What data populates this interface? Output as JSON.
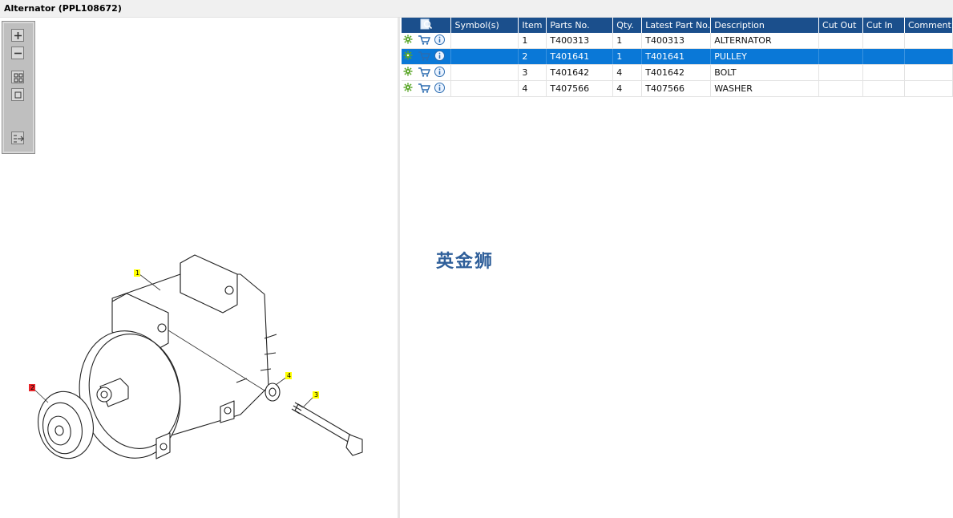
{
  "window": {
    "title": "Alternator (PPL108672)"
  },
  "toolbar": {
    "buttons": [
      {
        "name": "zoom-in",
        "icon": "plus-icon"
      },
      {
        "name": "zoom-out",
        "icon": "minus-icon"
      },
      {
        "name": "fit-all",
        "icon": "grid-icon"
      },
      {
        "name": "actual-size",
        "icon": "square-icon"
      },
      {
        "name": "toggle-list",
        "icon": "list-arrow-icon"
      }
    ]
  },
  "drawing": {
    "callouts": [
      "1",
      "2",
      "3",
      "4"
    ]
  },
  "table": {
    "headers": {
      "symbols": "Symbol(s)",
      "item": "Item",
      "parts_no": "Parts No.",
      "qty": "Qty.",
      "latest": "Latest Part No.",
      "description": "Description",
      "cut_out": "Cut Out",
      "cut_in": "Cut In",
      "comment": "Comment"
    },
    "rows": [
      {
        "symbols": "",
        "item": "1",
        "parts_no": "T400313",
        "qty": "1",
        "latest": "T400313",
        "description": "ALTERNATOR",
        "cut_out": "",
        "cut_in": "",
        "comment": ""
      },
      {
        "symbols": "",
        "item": "2",
        "parts_no": "T401641",
        "qty": "1",
        "latest": "T401641",
        "description": "PULLEY",
        "cut_out": "",
        "cut_in": "",
        "comment": ""
      },
      {
        "symbols": "",
        "item": "3",
        "parts_no": "T401642",
        "qty": "4",
        "latest": "T401642",
        "description": "BOLT",
        "cut_out": "",
        "cut_in": "",
        "comment": ""
      },
      {
        "symbols": "",
        "item": "4",
        "parts_no": "T407566",
        "qty": "4",
        "latest": "T407566",
        "description": "WASHER",
        "cut_out": "",
        "cut_in": "",
        "comment": ""
      }
    ],
    "selected_row": 1
  },
  "watermark": "英金狮",
  "colors": {
    "header": "#1b4f8c",
    "selected": "#0a78d7",
    "callout_yellow": "#ffff00",
    "callout_red": "#e8262a"
  }
}
